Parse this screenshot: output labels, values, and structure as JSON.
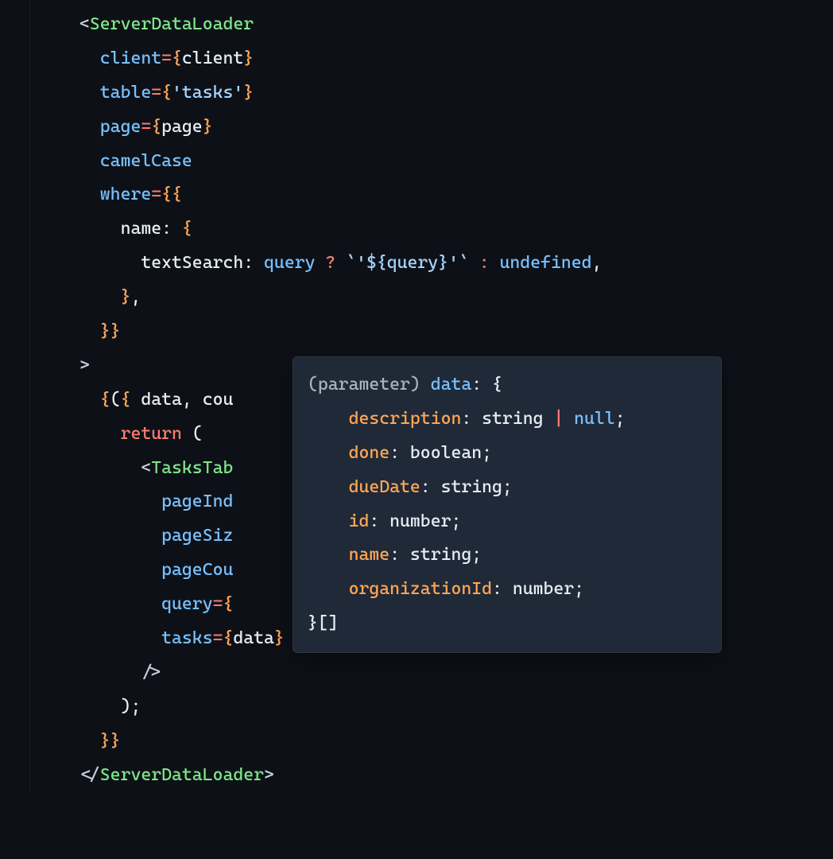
{
  "code": {
    "componentOpen": "ServerDataLoader",
    "componentClose": "ServerDataLoader",
    "attr_client": "client",
    "val_client": "client",
    "attr_table": "table",
    "val_table": "'tasks'",
    "attr_page": "page",
    "val_page": "page",
    "attr_camelCase": "camelCase",
    "attr_where": "where",
    "where_key_name": "name",
    "where_key_textSearch": "textSearch",
    "where_query": "query",
    "where_template": "`'${query}'`",
    "where_undefined": "undefined",
    "destructure": "data, cou",
    "kw_return": "return",
    "childComponent": "TasksTab",
    "child_attr_pageIndex": "pageInd",
    "child_attr_pageSize": "pageSiz",
    "child_attr_pageCount": "pageCou",
    "child_attr_query": "query",
    "child_attr_tasks": "tasks",
    "child_val_tasks": "data",
    "arrow_rest": " {"
  },
  "tooltip": {
    "paramLabel": "(parameter)",
    "paramName": "data",
    "fields": [
      {
        "name": "description",
        "type": "string | null"
      },
      {
        "name": "done",
        "type": "boolean"
      },
      {
        "name": "dueDate",
        "type": "string"
      },
      {
        "name": "id",
        "type": "number"
      },
      {
        "name": "name",
        "type": "string"
      },
      {
        "name": "organizationId",
        "type": "number"
      }
    ],
    "arraySuffix": "[]"
  }
}
